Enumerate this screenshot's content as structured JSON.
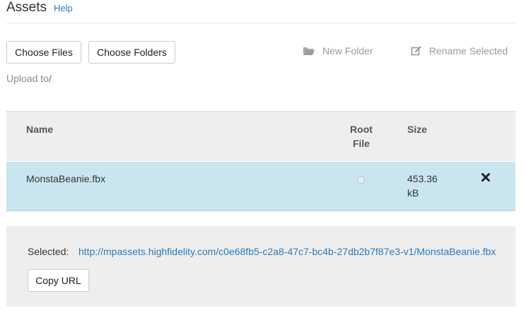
{
  "header": {
    "title": "Assets",
    "help_label": "Help"
  },
  "toolbar": {
    "choose_files_label": "Choose Files",
    "choose_folders_label": "Choose Folders",
    "new_folder_label": "New Folder",
    "rename_selected_label": "Rename Selected"
  },
  "upload": {
    "label": "Upload to",
    "path": "/"
  },
  "table": {
    "columns": {
      "name": "Name",
      "root_file_line1": "Root",
      "root_file_line2": "File",
      "size": "Size"
    },
    "rows": [
      {
        "name": "MonstaBeanie.fbx",
        "size_value": "453.36",
        "size_unit": "kB",
        "root_file": false
      }
    ]
  },
  "selected": {
    "label": "Selected:",
    "url": "http://mpassets.highfidelity.com/c0e68fb5-c2a8-47c7-bc4b-27db2b7f87e3-v1/MonstaBeanie.fbx",
    "copy_label": "Copy URL"
  },
  "colors": {
    "link": "#2a7bb5",
    "selected_row": "#c9e6ee",
    "panel": "#eeeeee",
    "muted": "#9a9a9a"
  }
}
